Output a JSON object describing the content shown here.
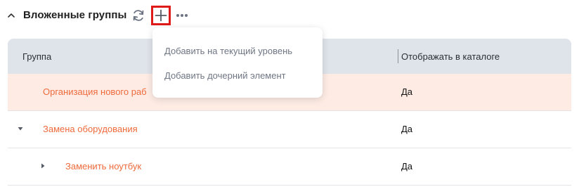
{
  "section": {
    "title": "Вложенные группы"
  },
  "icons": {
    "collapse": "chevron-up-icon",
    "refresh": "refresh-icon",
    "add": "plus-icon",
    "more": "more-horizontal-icon"
  },
  "colors": {
    "accent_link": "#ef6a3c",
    "header_bg": "#dfe3ea",
    "highlight_row": "#fdebe4",
    "focus_border": "#e01919"
  },
  "table": {
    "columns": [
      "Группа",
      "Отображать в каталоге"
    ],
    "rows": [
      {
        "name": "Организация нового раб",
        "display": "Да"
      },
      {
        "name": "Замена оборудования",
        "display": "Да"
      },
      {
        "name": "Заменить ноутбук",
        "display": "Да"
      }
    ]
  },
  "dropdown": {
    "items": [
      "Добавить на текущий уровень",
      "Добавить дочерний элемент"
    ]
  }
}
